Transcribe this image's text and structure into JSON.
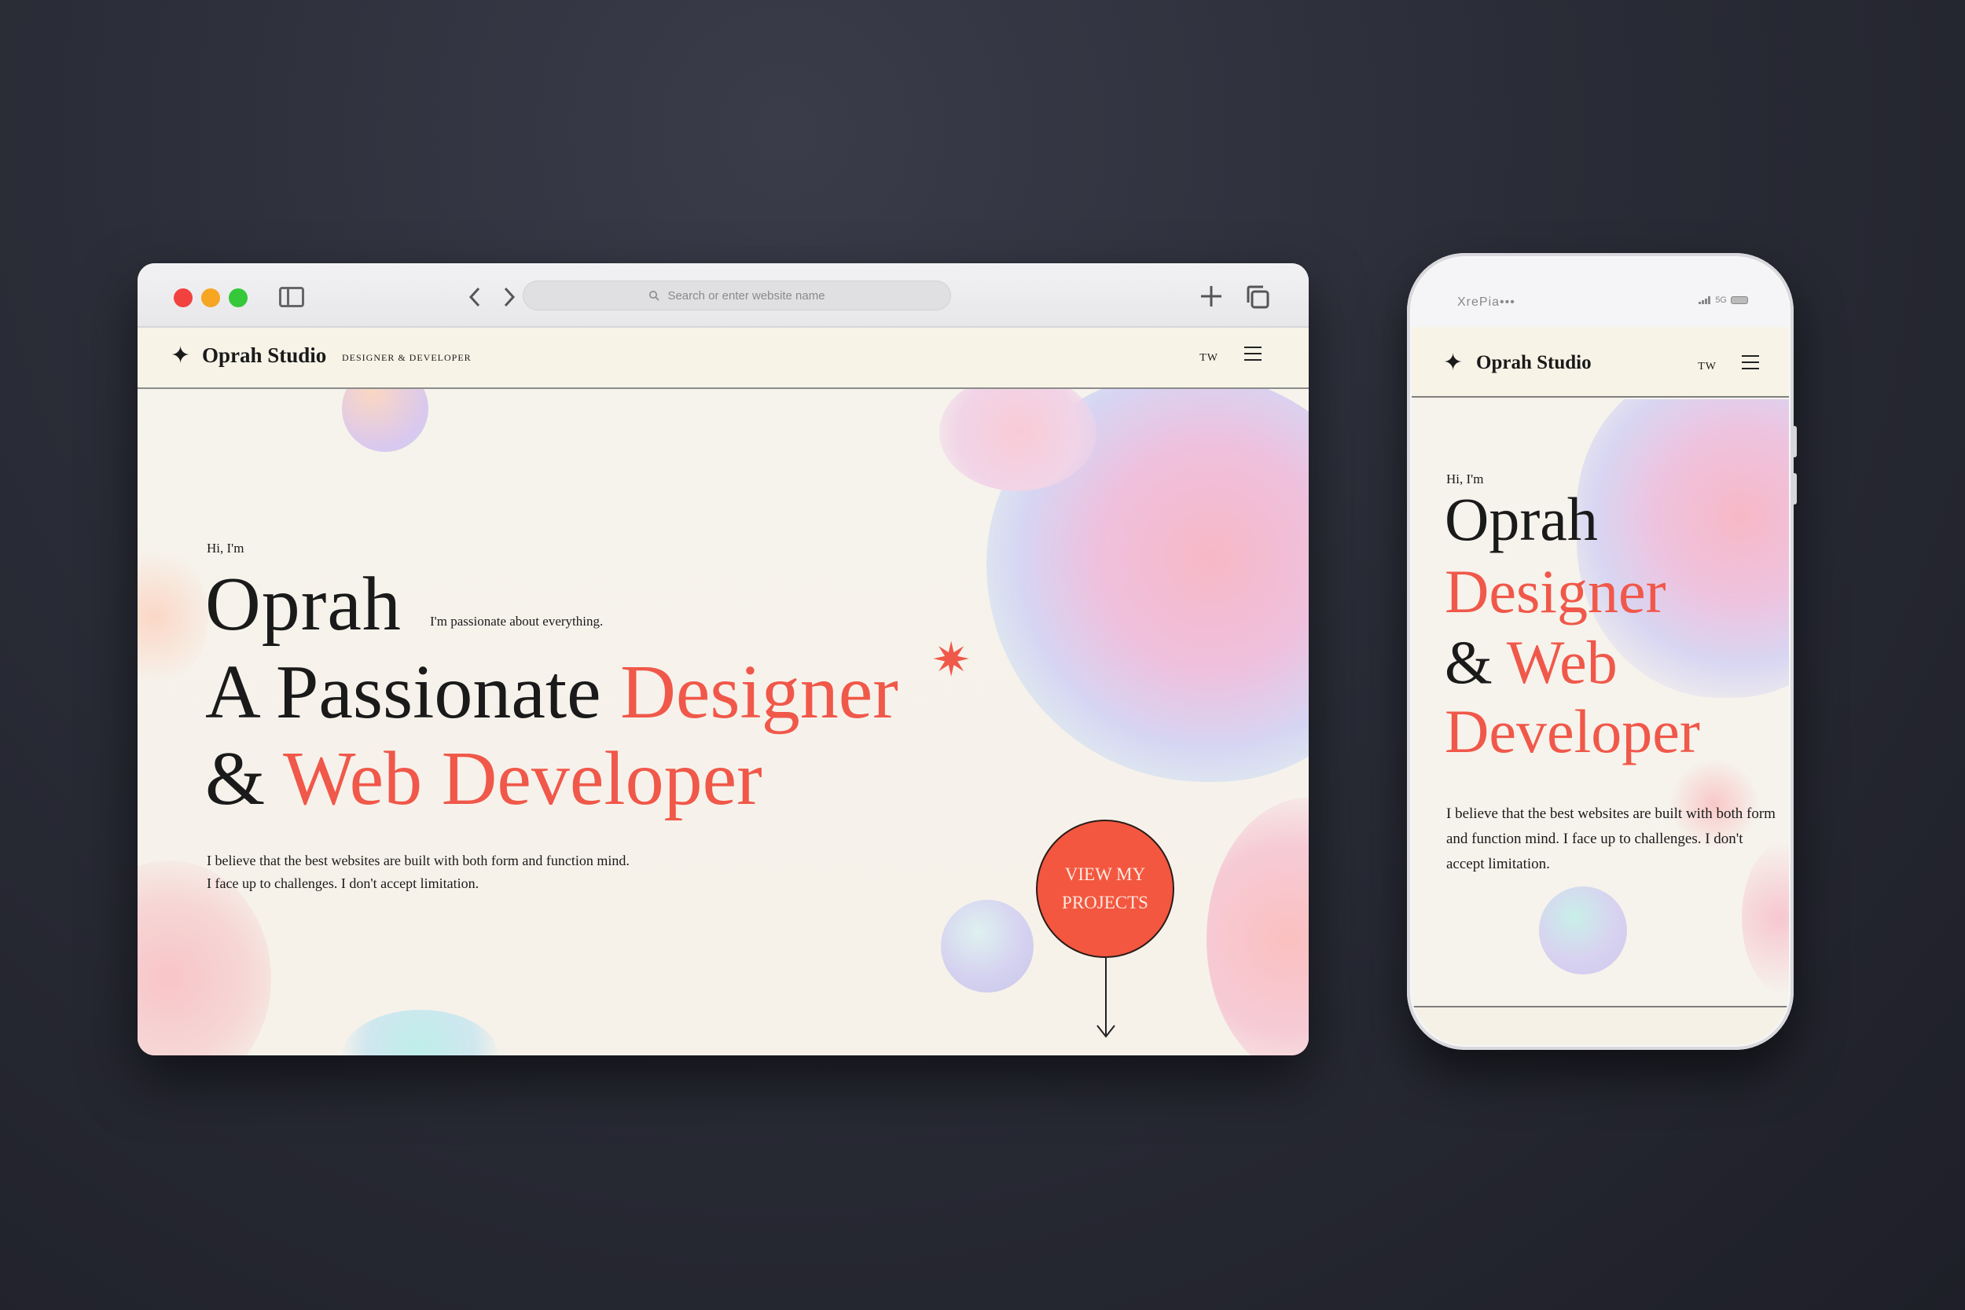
{
  "browser": {
    "address_placeholder": "Search or enter website name",
    "icons": [
      "sidebar-toggle-icon",
      "back-icon",
      "forward-icon",
      "search-icon",
      "new-tab-icon",
      "tabs-overview-icon"
    ]
  },
  "site": {
    "brand": "Oprah Studio",
    "tagline": "DESIGNER & DEVELOPER",
    "nav_tw": "TW",
    "greeting": "Hi, I'm",
    "name": "Oprah",
    "passion": "I'm passionate about everything.",
    "headline_part1": "A Passionate ",
    "headline_accent1": "Designer",
    "headline_amp": "& ",
    "headline_accent2": "Web Developer",
    "body_line1": "I believe that the best websites are built with both form and function mind.",
    "body_line2": "I face up to challenges. I don't accept limitation.",
    "cta_line1": "VIEW MY",
    "cta_line2": "PROJECTS"
  },
  "phone": {
    "carrier": "XrePia•••",
    "network": "5G",
    "brand": "Oprah Studio",
    "nav_tw": "TW",
    "greeting": "Hi, I'm",
    "name": "Oprah",
    "line_designer": "Designer",
    "line_amp": "& ",
    "line_web": "Web",
    "line_developer": "Developer",
    "body": "I believe that the best websites are built with both form and function mind. I face up to challenges. I don't accept limitation."
  },
  "colors": {
    "accent": "#f0584a",
    "cta_fill": "#f3573f",
    "background": "#2a2c37",
    "page_bg": "#f6f3ec"
  }
}
